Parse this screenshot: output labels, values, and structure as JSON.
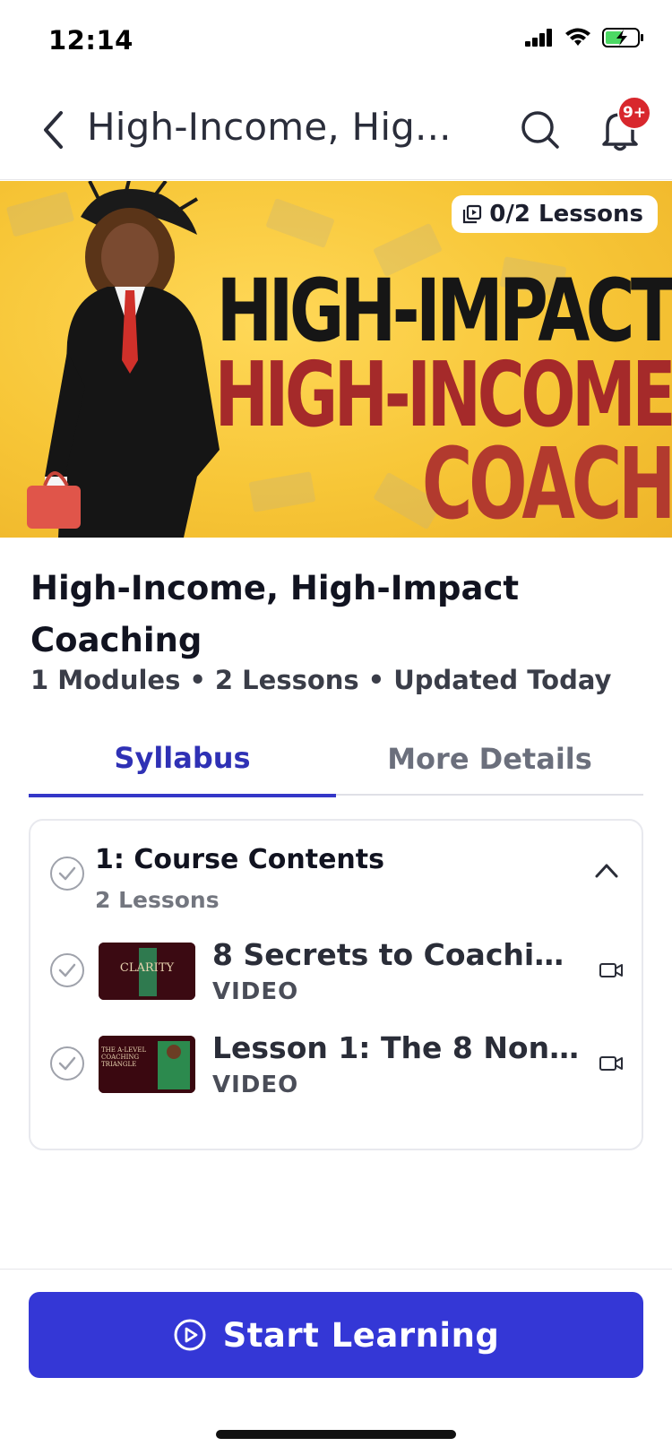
{
  "status_bar": {
    "time": "12:14"
  },
  "header": {
    "title": "High-Income, Hig...",
    "notification_badge": "9+"
  },
  "hero": {
    "lessons_pill": "0/2 Lessons",
    "line1": "HIGH-IMPACT",
    "line2": "HIGH-INCOME",
    "line3": "COACH"
  },
  "course": {
    "title": "High-Income, High-Impact Coaching",
    "modules": "1 Modules",
    "lessons": "2 Lessons",
    "updated": "Updated Today",
    "separator": "•"
  },
  "tabs": [
    {
      "label": "Syllabus",
      "active": true
    },
    {
      "label": "More Details",
      "active": false
    }
  ],
  "module": {
    "title": "1: Course Contents",
    "subtitle": "2 Lessons",
    "lessons": [
      {
        "title": "8 Secrets to Coachin...",
        "type": "VIDEO",
        "thumb_text": "CLARITY"
      },
      {
        "title": "Lesson 1: The 8 Non-...",
        "type": "VIDEO",
        "thumb_text": "THE A-LEVEL COACHING TRIANGLE"
      }
    ]
  },
  "cta": {
    "label": "Start Learning"
  },
  "colors": {
    "accent": "#3437d6",
    "tab_active": "#2f31b5",
    "badge": "#d8272d",
    "hero_bg": "#f7c637"
  }
}
